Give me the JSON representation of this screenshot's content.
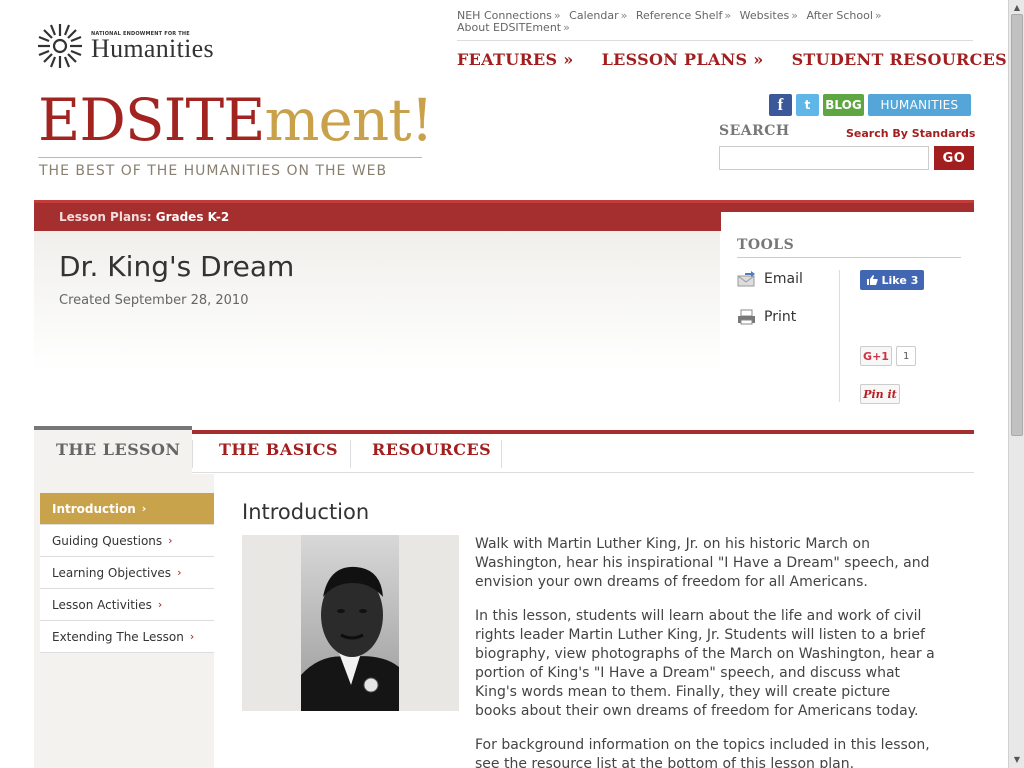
{
  "logo": {
    "small_text": "NATIONAL ENDOWMENT FOR THE",
    "big_text": "Humanities"
  },
  "toplinks": [
    "NEH Connections",
    "Calendar",
    "Reference Shelf",
    "Websites",
    "After School",
    "About EDSITEment"
  ],
  "toplink_separator": "»",
  "mainnav": [
    "FEATURES »",
    "LESSON PLANS »",
    "STUDENT RESOURCES »"
  ],
  "brand": {
    "part1": "EDSITE",
    "part2": "ment!",
    "tagline": "THE BEST OF THE HUMANITIES ON THE WEB",
    "color1": "#a12421",
    "color2": "#c9a14a"
  },
  "social": {
    "facebook": "f",
    "twitter": "t",
    "blog": "BLOG",
    "humanities": "HUMANITIES"
  },
  "search": {
    "label": "SEARCH",
    "by_standards": "Search By Standards",
    "go": "GO",
    "value": ""
  },
  "breadcrumb": {
    "prefix": "Lesson Plans:",
    "value": "Grades K-2"
  },
  "lesson": {
    "title": "Dr. King's Dream",
    "created": "Created September 28, 2010"
  },
  "tools": {
    "label": "TOOLS",
    "email": "Email",
    "print": "Print",
    "like": "Like",
    "like_count": "3",
    "gplus": "G+1",
    "gplus_count": "1",
    "pin": "Pin it"
  },
  "tabs": [
    "THE LESSON",
    "THE BASICS",
    "RESOURCES"
  ],
  "sidenav": [
    {
      "label": "Introduction",
      "active": true
    },
    {
      "label": "Guiding Questions",
      "active": false
    },
    {
      "label": "Learning Objectives",
      "active": false
    },
    {
      "label": "Lesson Activities",
      "active": false
    },
    {
      "label": "Extending The Lesson",
      "active": false
    }
  ],
  "content": {
    "heading": "Introduction",
    "paragraphs": [
      "Walk with Martin Luther King, Jr. on his historic March on Washington, hear his inspirational \"I Have a Dream\" speech, and envision your own dreams of freedom for all Americans.",
      "In this lesson, students will learn about the life and work of civil rights leader Martin Luther King, Jr. Students will listen to a brief biography, view photographs of the March on Washington, hear a portion of King's \"I Have a Dream\" speech, and discuss what King's words mean to them. Finally, they will create picture books about their own dreams of freedom for Americans today.",
      "For background information on the topics included in this lesson, see the resource list at the bottom of this lesson plan."
    ]
  },
  "colors": {
    "accent_red": "#a31f1f",
    "gold": "#c9a24c"
  }
}
